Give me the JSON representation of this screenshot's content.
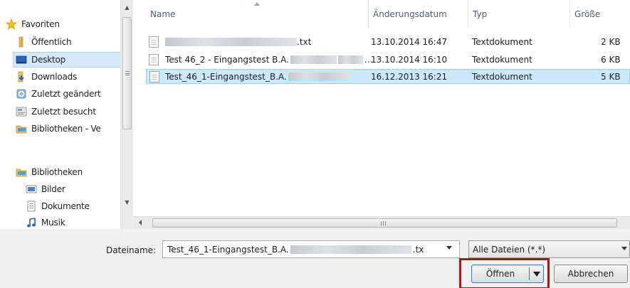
{
  "nav": {
    "items": [
      {
        "label": "Favoriten",
        "icon": "star-icon"
      },
      {
        "label": "Öffentlich",
        "icon": "folder-icon"
      },
      {
        "label": "Desktop",
        "icon": "desktop-icon"
      },
      {
        "label": "Downloads",
        "icon": "downloads-folder-icon"
      },
      {
        "label": "Zuletzt geändert",
        "icon": "recent-changes-icon"
      },
      {
        "label": "Zuletzt besucht",
        "icon": "recent-places-icon"
      },
      {
        "label": "Bibliotheken - Ve",
        "icon": "libraries-icon"
      },
      {
        "label": "Bibliotheken",
        "icon": "libraries-icon"
      },
      {
        "label": "Bilder",
        "icon": "pictures-icon"
      },
      {
        "label": "Dokumente",
        "icon": "documents-icon"
      },
      {
        "label": "Musik",
        "icon": "music-icon"
      }
    ]
  },
  "file_list": {
    "columns": {
      "name": "Name",
      "date": "Änderungsdatum",
      "type": "Typ",
      "size": "Größe"
    },
    "rows": [
      {
        "name_prefix": "",
        "name_suffix": ".txt",
        "date": "13.10.2014 16:47",
        "type": "Textdokument",
        "size": "2 KB"
      },
      {
        "name_prefix": "Test 46_2 - Eingangstest B.A.",
        "name_suffix": "...",
        "date": "13.10.2014 16:10",
        "type": "Textdokument",
        "size": "6 KB"
      },
      {
        "name_prefix": "Test_46_1-Eingangstest_B.A.",
        "name_suffix": "",
        "date": "16.12.2013 16:21",
        "type": "Textdokument",
        "size": "5 KB"
      }
    ]
  },
  "bottom": {
    "filename_label": "Dateiname:",
    "filename_prefix": "Test_46_1-Eingangstest_B.A.",
    "filename_suffix": ".tx",
    "filter_value": "Alle Dateien (*.*)",
    "open_label": "Öffnen",
    "cancel_label": "Abbrechen"
  },
  "colors": {
    "highlight": "#b3121a",
    "selection": "#cce8ff",
    "header_text": "#4c607a"
  }
}
